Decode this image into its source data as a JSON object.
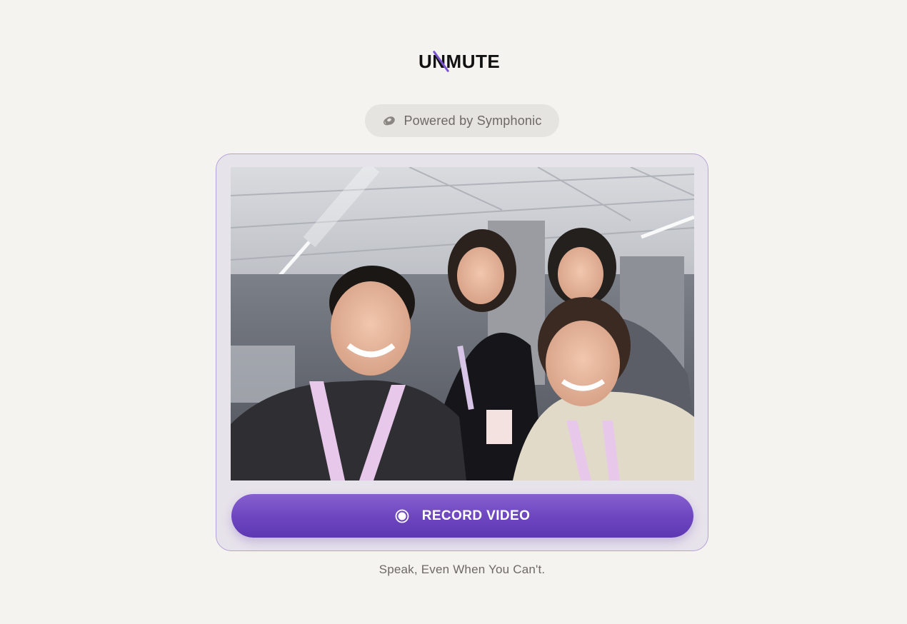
{
  "logo": {
    "text": "UNMUTE",
    "accent_color": "#7b55d0"
  },
  "powered_by": {
    "icon": "symphonic-logo-icon",
    "label": "Powered by Symphonic"
  },
  "camera": {
    "feed": "live-camera-preview"
  },
  "record_button": {
    "icon": "record-icon",
    "label": "RECORD VIDEO",
    "color": "#6c45bf"
  },
  "tagline": "Speak, Even When You Can't.",
  "colors": {
    "background": "#f4f3ef",
    "card": "#e7e3ea",
    "card_border": "#b6a2d8",
    "accent": "#6c45bf"
  }
}
